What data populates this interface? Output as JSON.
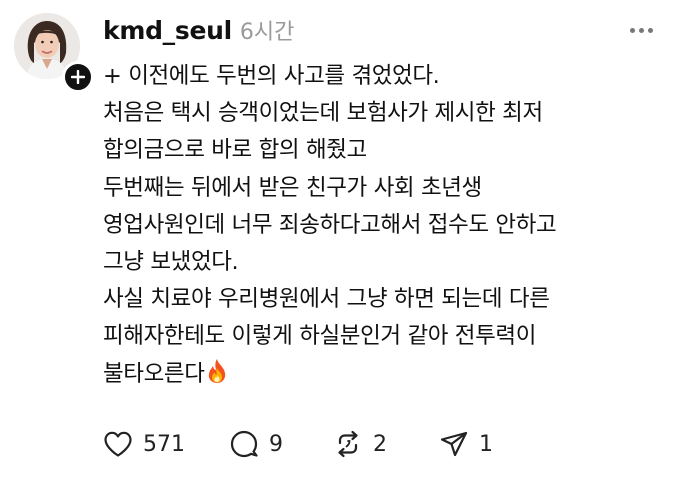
{
  "post": {
    "author": {
      "username": "kmd_seul",
      "avatar": "avatar",
      "follow_icon": "plus-icon"
    },
    "timestamp": "6시간",
    "menu_icon": "more-icon",
    "text_lines": [
      "+ 이전에도 두번의 사고를 겪었었다.",
      "처음은 택시 승객이었는데 보험사가 제시한 최저",
      "합의금으로 바로 합의 해줬고",
      "두번째는 뒤에서 받은 친구가 사회 초년생",
      "영업사원인데 너무 죄송하다고해서 접수도 안하고",
      "그냥 보냈었다.",
      "사실 치료야 우리병원에서 그냥 하면 되는데 다른",
      "피해자한테도 이렇게 하실분인거 같아 전투력이",
      "불타오른다"
    ],
    "emoji": "fire-emoji",
    "actions": {
      "like": {
        "icon": "heart-icon",
        "count": "571"
      },
      "reply": {
        "icon": "comment-icon",
        "count": "9"
      },
      "repost": {
        "icon": "repost-icon",
        "count": "2"
      },
      "share": {
        "icon": "send-icon",
        "count": "1"
      }
    },
    "colors": {
      "text": "#111111",
      "timestamp": "#9a9a9a",
      "icon": "#222222"
    }
  }
}
